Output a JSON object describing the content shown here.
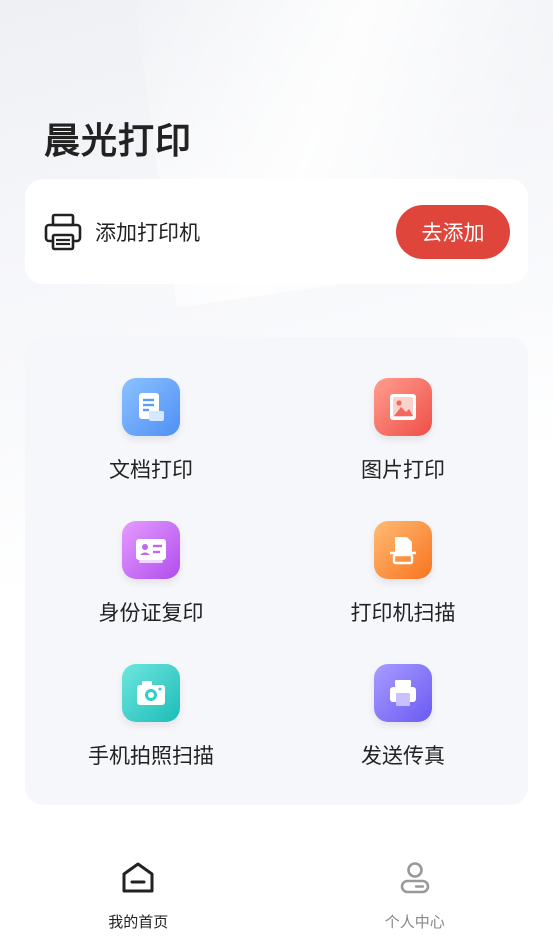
{
  "header": {
    "app_title": "晨光打印"
  },
  "printer_card": {
    "label": "添加打印机",
    "add_button_label": "去添加"
  },
  "features": [
    {
      "label": "文档打印",
      "icon": "document-icon",
      "color": "#5a9df8"
    },
    {
      "label": "图片打印",
      "icon": "image-icon",
      "color": "#f3675c"
    },
    {
      "label": "身份证复印",
      "icon": "id-card-icon",
      "color": "#c265f2"
    },
    {
      "label": "打印机扫描",
      "icon": "scanner-icon",
      "color": "#fb8a37"
    },
    {
      "label": "手机拍照扫描",
      "icon": "camera-icon",
      "color": "#2fd0c8"
    },
    {
      "label": "发送传真",
      "icon": "fax-icon",
      "color": "#7a6cf5"
    }
  ],
  "tabbar": {
    "items": [
      {
        "label": "我的首页",
        "icon": "home-icon",
        "active": true
      },
      {
        "label": "个人中心",
        "icon": "profile-icon",
        "active": false
      }
    ]
  },
  "colors": {
    "accent": "#e0453b",
    "panel_bg": "#f6f7fb",
    "text": "#222222",
    "muted": "#888888"
  }
}
